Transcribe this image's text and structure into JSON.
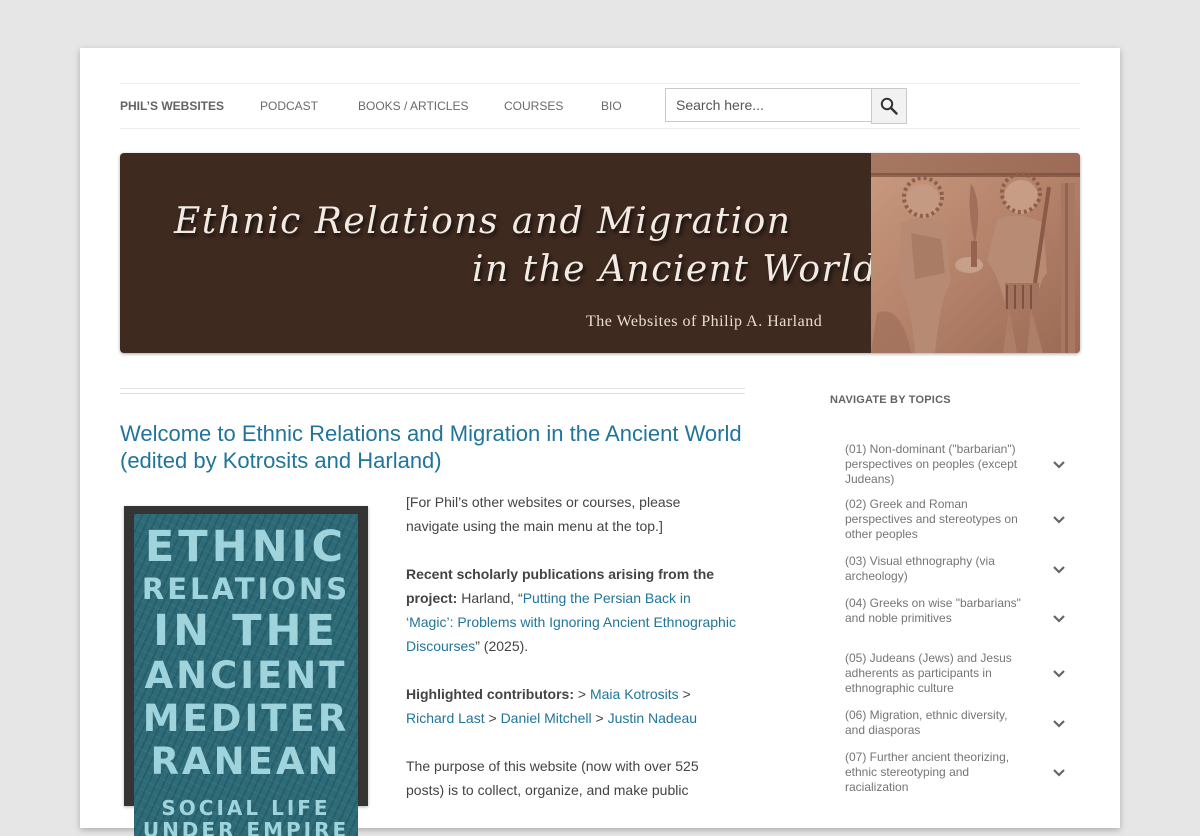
{
  "nav": {
    "items": [
      "PHIL’S WEBSITES",
      "PODCAST",
      "BOOKS / ARTICLES",
      "COURSES",
      "BIO"
    ],
    "search_placeholder": "Search here..."
  },
  "banner": {
    "title_line1": "Ethnic Relations and Migration",
    "title_line2": "in the Ancient World",
    "subtitle": "The Websites of Philip A. Harland"
  },
  "post": {
    "title": "Welcome to Ethnic Relations and Migration in the Ancient World (edited by Kotrosits and Harland)",
    "book_cover_lines": [
      "ETHNIC",
      "RELATIONS",
      "IN THE",
      "ANCIENT",
      "MEDITER",
      "RANEAN",
      "SOCIAL LIFE",
      "UNDER EMPIRE"
    ],
    "intro": "[For Phil’s other websites or courses, please navigate using the main menu at the top.]",
    "pubs_label": "Recent scholarly publications arising from the project:",
    "pubs_author": " Harland, “",
    "pubs_link": "Putting the Persian Back in ‘Magic’: Problems with Ignoring Ancient Ethnographic Discourses",
    "pubs_end": "” (2025).",
    "contrib_label": "Highlighted contributors:",
    "contrib_sep1": " > ",
    "contrib_sep2": " > ",
    "contrib_sep3": " > ",
    "contrib_sep4": "  > ",
    "contributors": [
      "Maia Kotrosits",
      "Richard Last",
      "Daniel Mitchell",
      "Justin Nadeau"
    ],
    "purpose": "The purpose of this website (now with over 525 posts) is to collect, organize, and make public"
  },
  "sidebar": {
    "title": "NAVIGATE BY TOPICS",
    "topics": [
      "(01) Non-dominant (\"barbarian\") perspectives on peoples (except Judeans)",
      "(02) Greek and Roman perspectives and stereotypes on other peoples",
      "(03) Visual ethnography (via archeology)",
      "(04) Greeks on wise \"barbarians\" and noble primitives",
      "(05) Judeans (Jews) and Jesus adherents as participants in ethnographic culture",
      "(06) Migration, ethnic diversity, and diasporas",
      "(07) Further ancient theorizing, ethnic stereotyping and racialization"
    ]
  },
  "colors": {
    "link": "#21759b",
    "banner_bg": "#3f2a20",
    "page_bg": "#e6e6e6"
  }
}
